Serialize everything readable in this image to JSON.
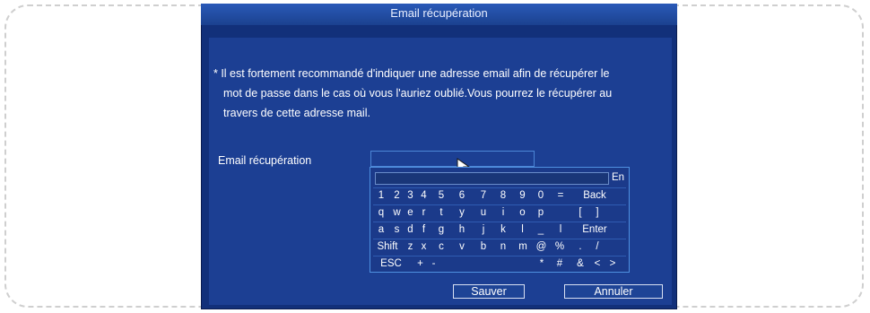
{
  "dialog": {
    "title": "Email récupération",
    "notice_lines": [
      "* Il est fortement recommandé d'indiquer une adresse email afin de récupérer le",
      "mot de passe dans le cas où vous l'auriez oublié.Vous pourrez le récupérer au",
      "travers de cette adresse mail."
    ],
    "email_label": "Email récupération",
    "email_value": "",
    "save_label": "Sauver",
    "cancel_label": "Annuler"
  },
  "keyboard": {
    "input_value": "",
    "language": "En",
    "rows": [
      [
        "1",
        "2",
        "3",
        "4",
        "5",
        "6",
        "7",
        "8",
        "9",
        "0",
        "=",
        "Back"
      ],
      [
        "q",
        "w",
        "e",
        "r",
        "t",
        "y",
        "u",
        "i",
        "o",
        "p",
        "",
        "[",
        "]"
      ],
      [
        "a",
        "s",
        "d",
        "f",
        "g",
        "h",
        "j",
        "k",
        "l",
        "_",
        "l",
        "Enter"
      ],
      [
        "Shift",
        "z",
        "x",
        "c",
        "v",
        "b",
        "n",
        "m",
        "@",
        "%",
        ".",
        "/"
      ],
      [
        "ESC",
        "+",
        "-",
        "",
        "",
        "",
        "",
        "*",
        "#",
        "&",
        "<",
        ">"
      ]
    ]
  },
  "colors": {
    "dialog_bg": "#12307a",
    "panel_bg": "#1c3f93",
    "field_border": "#4c86d6",
    "button_border": "#d8e0f2"
  },
  "icons": {
    "pointer": "mouse-pointer-icon"
  }
}
